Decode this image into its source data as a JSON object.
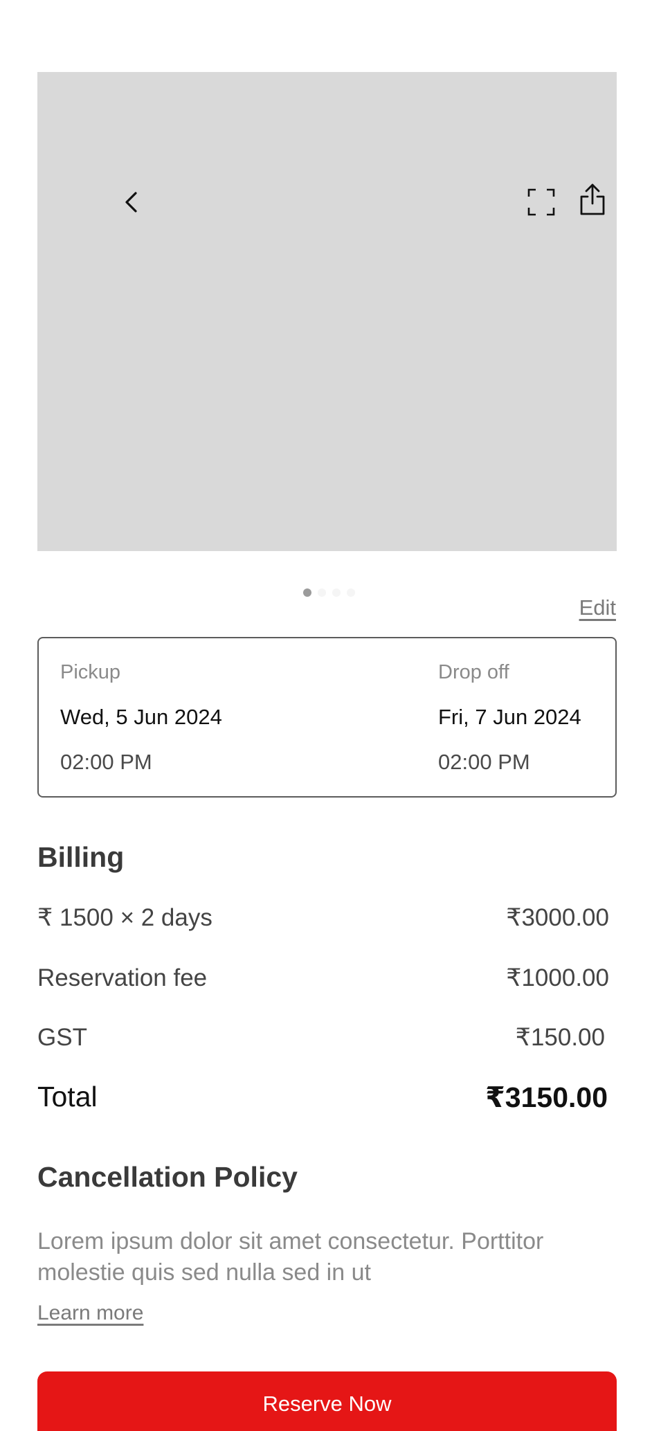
{
  "hero": {
    "back_icon": "chevron-left-icon",
    "fullscreen_icon": "fullscreen-icon",
    "share_icon": "share-icon",
    "slides_total": 4,
    "slide_active": 1
  },
  "edit_label": "Edit",
  "trip": {
    "pickup": {
      "label": "Pickup",
      "date": "Wed, 5 Jun 2024",
      "time": "02:00 PM"
    },
    "dropoff": {
      "label": "Drop off",
      "date": "Fri, 7 Jun 2024",
      "time": "02:00 PM"
    }
  },
  "billing": {
    "title": "Billing",
    "rows": [
      {
        "label": "₹ 1500 × 2 days",
        "amount": "₹3000.00"
      },
      {
        "label": "Reservation fee",
        "amount": "₹1000.00"
      },
      {
        "label": "GST",
        "amount": "₹150.00"
      }
    ],
    "total_label": "Total",
    "total_amount": "₹3150.00"
  },
  "policy": {
    "title": "Cancellation Policy",
    "text": "Lorem ipsum dolor sit amet consectetur. Porttitor molestie quis sed nulla sed in ut",
    "learn_more": "Learn more"
  },
  "cta": {
    "label": "Reserve Now"
  },
  "colors": {
    "accent": "#E51616",
    "image_placeholder": "#D9D9D9"
  }
}
